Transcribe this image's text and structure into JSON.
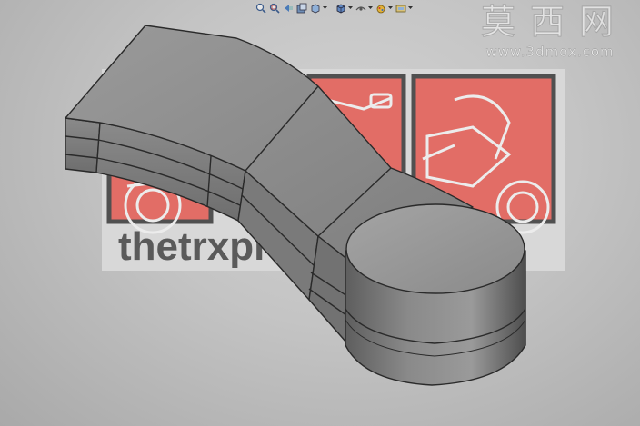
{
  "decal": {
    "brand_text": "thetrxproject.com",
    "panel_color": "#e26d66",
    "frame_color": "#505050",
    "backing_color": "#d8d8d8"
  },
  "watermark": {
    "chinese": "莫西网",
    "url": "www.3dmox.com"
  },
  "toolbar": {
    "icons": [
      "zoom-to-fit-icon",
      "zoom-area-icon",
      "previous-view-icon",
      "section-view-icon",
      "view-orientation-icon",
      "display-style-icon",
      "hide-show-items-icon",
      "edit-appearance-icon",
      "apply-scene-icon"
    ]
  },
  "model": {
    "part": "rocker-arm",
    "body_color": "#8c8c8c",
    "edge_color": "#2a2a2a"
  }
}
